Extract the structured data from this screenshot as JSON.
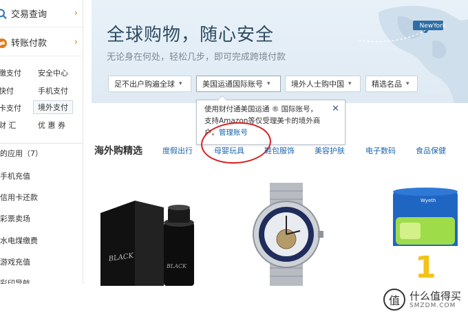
{
  "sidebar": {
    "main_items": [
      {
        "label": "交易查询",
        "icon": "search-icon"
      },
      {
        "label": "转账付款",
        "icon": "transfer-icon"
      }
    ],
    "grid": [
      {
        "label": "缴支付",
        "col": 0
      },
      {
        "label": "安全中心",
        "col": 1
      },
      {
        "label": "快付",
        "col": 0
      },
      {
        "label": "手机支付",
        "col": 1
      },
      {
        "label": "卡支付",
        "col": 0
      },
      {
        "label": "境外支付",
        "col": 1,
        "active": true
      },
      {
        "label": "财 汇",
        "col": 0
      },
      {
        "label": "优 惠 券",
        "col": 1
      }
    ],
    "apps_header": "的应用（7）",
    "apps": [
      "手机充值",
      "信用卡还款",
      "彩票卖场",
      "水电煤缴费",
      "游戏充值",
      "彩印导航"
    ]
  },
  "banner": {
    "title": "全球购物，随心安全",
    "subtitle": "无论身在何处，轻松几步，即可完成跨境付款",
    "city": "NewYork",
    "tabs": [
      {
        "label": "足不出户购遍全球",
        "caret": "chevron-down-icon"
      },
      {
        "label": "美国运通国际账号",
        "caret": "chevron-down-icon",
        "open": true
      },
      {
        "label": "境外人士购中国",
        "caret": "chevron-down-icon"
      },
      {
        "label": "精选名品",
        "caret": "chevron-down-icon"
      }
    ]
  },
  "tooltip": {
    "line1": "使用财付通美国运通 ® 国际账号，",
    "line2": "支持Amazon等仅受理美卡的境外商",
    "line3": "户。",
    "link": "管理账号",
    "close": "✕"
  },
  "picks": {
    "title": "海外购精选",
    "categories": [
      "度假出行",
      "母婴玩具",
      "鞋包服饰",
      "美容护肤",
      "电子数码",
      "食品保健"
    ]
  },
  "products": [
    {
      "name": "BLACK",
      "type": "perfume"
    },
    {
      "name": "watch",
      "type": "watch"
    },
    {
      "name": "Wyeth",
      "type": "milk-powder"
    }
  ],
  "watermark": {
    "glyph": "值",
    "cn": "什么值得买",
    "en": "SMZDM.COM"
  },
  "colors": {
    "accent": "#e07a16",
    "link": "#1a66b0",
    "highlight": "#d61e1e",
    "banner": "#e8f1f8"
  }
}
